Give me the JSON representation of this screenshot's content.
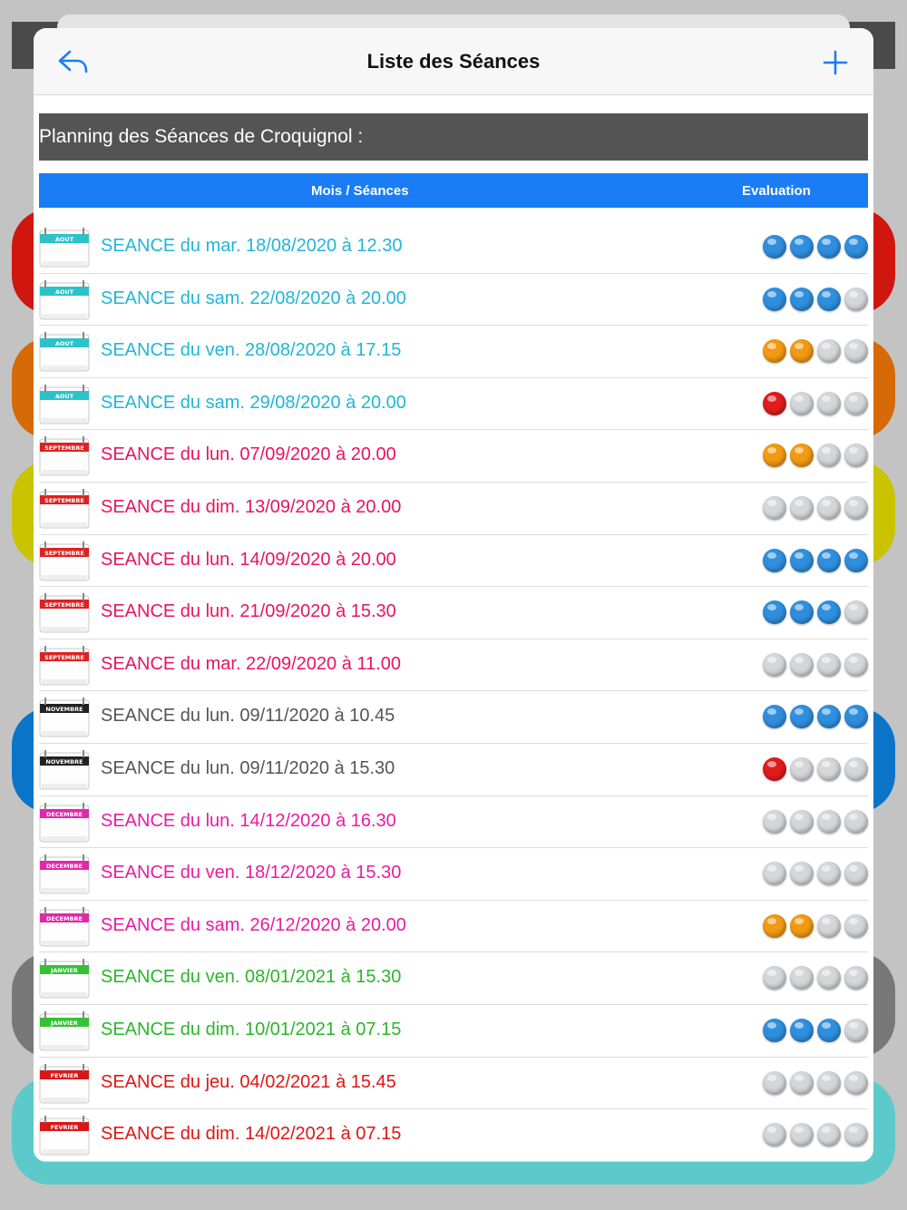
{
  "navbar": {
    "title": "Liste des Séances"
  },
  "planning_title": "Planning des Séances de Croquignol :",
  "columns": {
    "sessions": "Mois / Séances",
    "evaluation": "Evaluation"
  },
  "colors": {
    "aout": "#21b5d6",
    "septembre": "#e8155a",
    "novembre": "#555555",
    "decembre": "#e81ca0",
    "janvier": "#2bb52b",
    "fevrier": "#e01515",
    "header_blue": "#1a7df5"
  },
  "sessions": [
    {
      "month": "AOUT",
      "label": "SEANCE du mar. 18/08/2020 à 12.30",
      "rating": [
        "blue",
        "blue",
        "blue",
        "blue"
      ]
    },
    {
      "month": "AOUT",
      "label": "SEANCE du sam. 22/08/2020 à 20.00",
      "rating": [
        "blue",
        "blue",
        "blue",
        "grey"
      ]
    },
    {
      "month": "AOUT",
      "label": "SEANCE du ven. 28/08/2020 à 17.15",
      "rating": [
        "orange",
        "orange",
        "grey",
        "grey"
      ]
    },
    {
      "month": "AOUT",
      "label": "SEANCE du sam. 29/08/2020 à 20.00",
      "rating": [
        "red",
        "grey",
        "grey",
        "grey"
      ]
    },
    {
      "month": "SEPTEMBRE",
      "label": "SEANCE du lun. 07/09/2020 à 20.00",
      "rating": [
        "orange",
        "orange",
        "grey",
        "grey"
      ]
    },
    {
      "month": "SEPTEMBRE",
      "label": "SEANCE du dim. 13/09/2020 à 20.00",
      "rating": [
        "grey",
        "grey",
        "grey",
        "grey"
      ]
    },
    {
      "month": "SEPTEMBRE",
      "label": "SEANCE du lun. 14/09/2020 à 20.00",
      "rating": [
        "blue",
        "blue",
        "blue",
        "blue"
      ]
    },
    {
      "month": "SEPTEMBRE",
      "label": "SEANCE du lun. 21/09/2020 à 15.30",
      "rating": [
        "blue",
        "blue",
        "blue",
        "grey"
      ]
    },
    {
      "month": "SEPTEMBRE",
      "label": "SEANCE du mar. 22/09/2020 à 11.00",
      "rating": [
        "grey",
        "grey",
        "grey",
        "grey"
      ]
    },
    {
      "month": "NOVEMBRE",
      "label": "SEANCE du lun. 09/11/2020 à 10.45",
      "rating": [
        "blue",
        "blue",
        "blue",
        "blue"
      ]
    },
    {
      "month": "NOVEMBRE",
      "label": "SEANCE du lun. 09/11/2020 à 15.30",
      "rating": [
        "red",
        "grey",
        "grey",
        "grey"
      ]
    },
    {
      "month": "DECEMBRE",
      "label": "SEANCE du lun. 14/12/2020 à 16.30",
      "rating": [
        "grey",
        "grey",
        "grey",
        "grey"
      ]
    },
    {
      "month": "DECEMBRE",
      "label": "SEANCE du ven. 18/12/2020 à 15.30",
      "rating": [
        "grey",
        "grey",
        "grey",
        "grey"
      ]
    },
    {
      "month": "DECEMBRE",
      "label": "SEANCE du sam. 26/12/2020 à 20.00",
      "rating": [
        "orange",
        "orange",
        "grey",
        "grey"
      ]
    },
    {
      "month": "JANVIER",
      "label": "SEANCE du ven. 08/01/2021 à 15.30",
      "rating": [
        "grey",
        "grey",
        "grey",
        "grey"
      ]
    },
    {
      "month": "JANVIER",
      "label": "SEANCE du dim. 10/01/2021 à 07.15",
      "rating": [
        "blue",
        "blue",
        "blue",
        "grey"
      ]
    },
    {
      "month": "FEVRIER",
      "label": "SEANCE du jeu. 04/02/2021 à 15.45",
      "rating": [
        "grey",
        "grey",
        "grey",
        "grey"
      ]
    },
    {
      "month": "FEVRIER",
      "label": "SEANCE du dim. 14/02/2021 à 07.15",
      "rating": [
        "grey",
        "grey",
        "grey",
        "grey"
      ]
    }
  ]
}
